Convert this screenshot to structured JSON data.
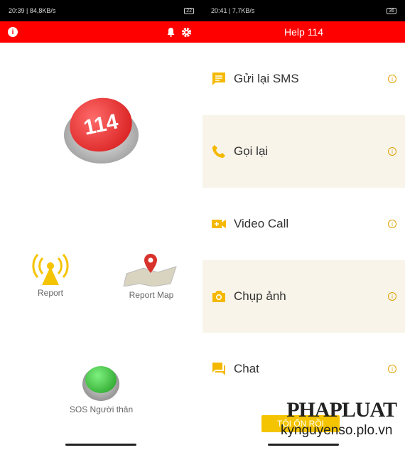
{
  "left": {
    "status": {
      "time": "20:39",
      "speed": "84,8KB/s",
      "battery": "22"
    },
    "center_button": "114",
    "report": "Report",
    "report_map": "Report Map",
    "sos": "SOS Người thân"
  },
  "right": {
    "status": {
      "time": "20:41",
      "speed": "7,7KB/s",
      "battery": "36"
    },
    "title": "Help 114",
    "items": [
      {
        "label": "Gửi lại SMS",
        "icon": "sms-icon"
      },
      {
        "label": "Gọi lại",
        "icon": "phone-icon"
      },
      {
        "label": "Video Call",
        "icon": "video-call-icon"
      },
      {
        "label": "Chụp ảnh",
        "icon": "camera-icon"
      },
      {
        "label": "Chat",
        "icon": "chat-icon"
      }
    ],
    "ok_button": "TÔI ỔN RỒI"
  },
  "watermark": {
    "brand": "PHAPLUAT",
    "site": "kynguyenso.plo.vn"
  },
  "colors": {
    "red": "#fe0000",
    "accent": "#f5b800",
    "alt_row": "#f8f4ea"
  }
}
